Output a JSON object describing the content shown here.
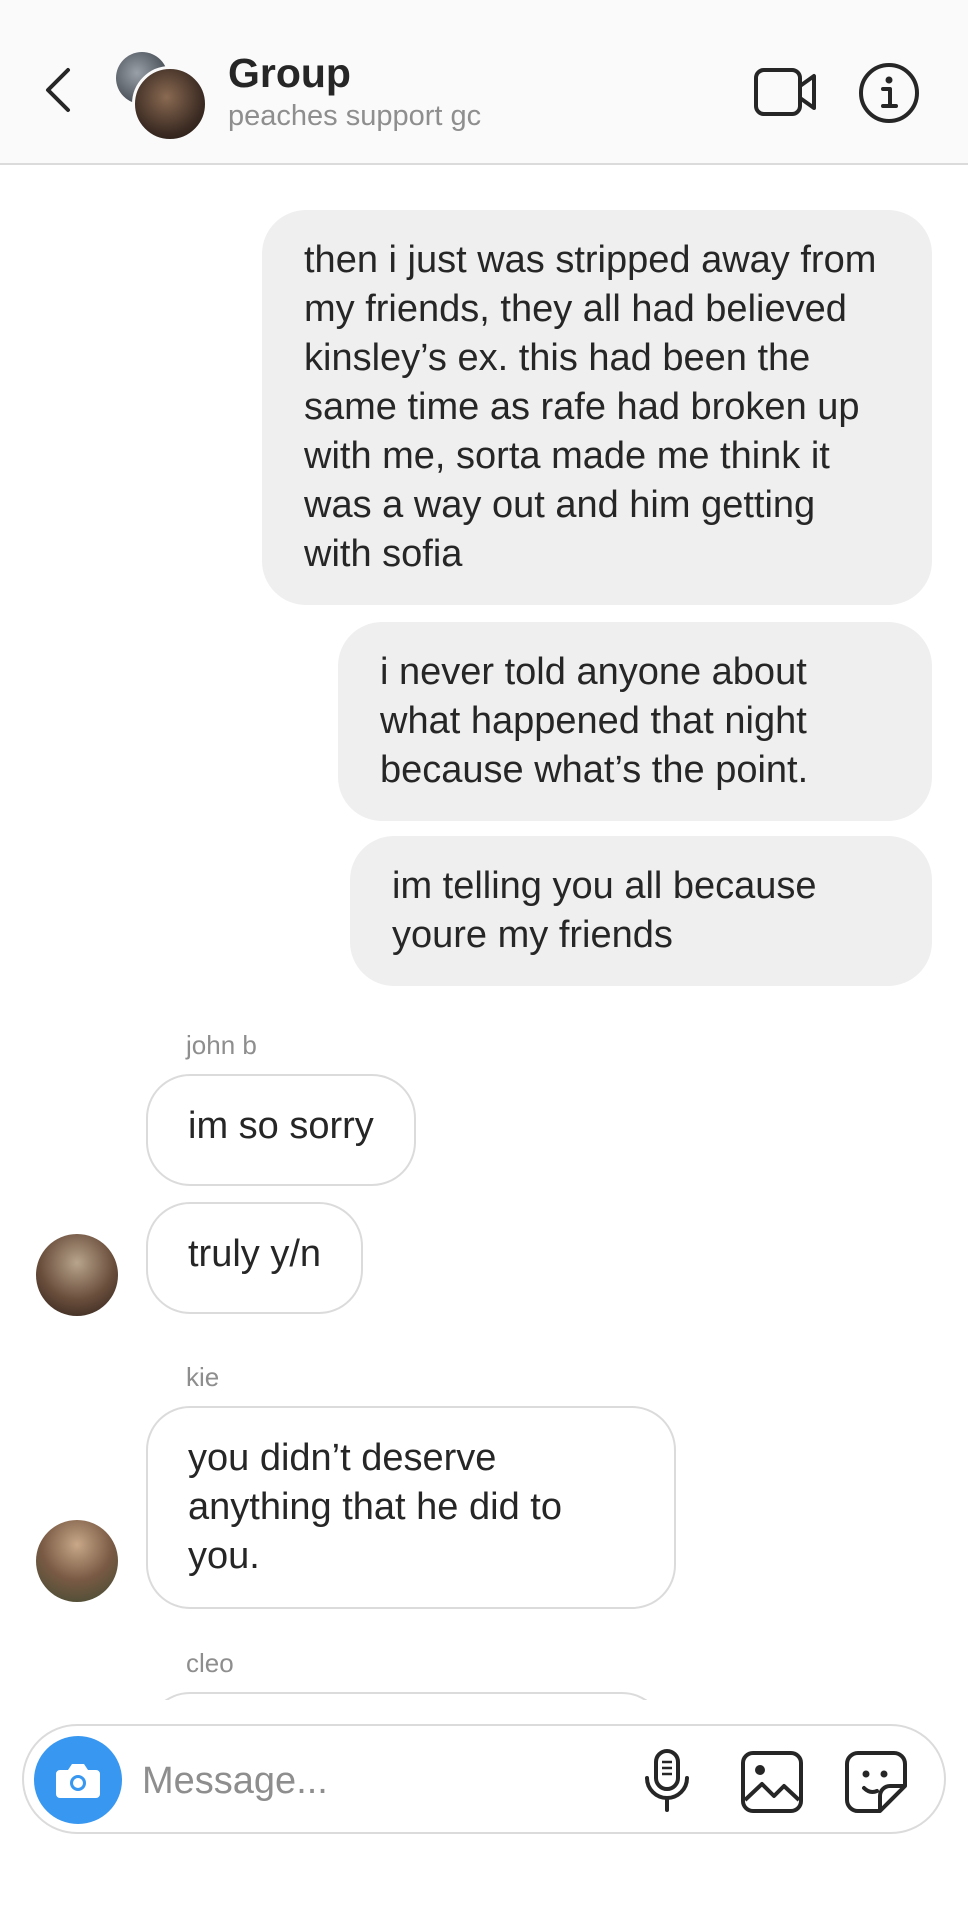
{
  "header": {
    "title": "Group",
    "subtitle": "peaches support gc",
    "back_icon": "chevron-left-icon",
    "video_icon": "video-camera-icon",
    "info_icon": "info-icon"
  },
  "messages": [
    {
      "direction": "outgoing",
      "text": "then i just was stripped away from my friends, they all had believed kinsley’s ex. this had been the same time as rafe had broken up with me, sorta made me think it was a way out and him getting with sofia"
    },
    {
      "direction": "outgoing",
      "text": "i never told anyone about what happened that night because what’s the point."
    },
    {
      "direction": "outgoing",
      "text": "im telling you all because youre my friends"
    },
    {
      "direction": "incoming",
      "sender": "john b",
      "text": "im so sorry"
    },
    {
      "direction": "incoming",
      "text": "truly y/n"
    },
    {
      "direction": "incoming",
      "sender": "kie",
      "text": "you didn’t deserve anything that he did to you."
    },
    {
      "direction": "incoming",
      "sender": "cleo",
      "text": ""
    }
  ],
  "composer": {
    "placeholder": "Message...",
    "camera_icon": "camera-icon",
    "mic_icon": "microphone-icon",
    "gallery_icon": "gallery-icon",
    "sticker_icon": "sticker-icon"
  },
  "colors": {
    "header_bg": "#fafafa",
    "outgoing_bubble": "#efefef",
    "incoming_border": "#dbdbdb",
    "secondary_text": "#8e8e8e",
    "accent": "#3897f0"
  }
}
